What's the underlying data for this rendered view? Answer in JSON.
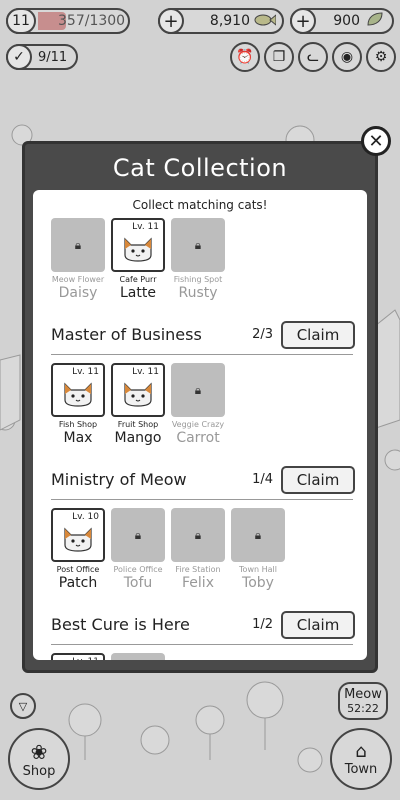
{
  "hud": {
    "level": "11",
    "xp": "357/1300",
    "fish": "8,910",
    "leaves": "900",
    "tasks": "9/11"
  },
  "modal": {
    "title": "Cat Collection",
    "subtitle": "Collect matching cats!",
    "close": "✕",
    "groups": [
      {
        "title": "",
        "count": "",
        "cats": [
          {
            "shop": "Meow Flower",
            "name": "Daisy",
            "unlocked": false
          },
          {
            "shop": "Cafe Purr",
            "name": "Latte",
            "unlocked": true,
            "level": "Lv. 11"
          },
          {
            "shop": "Fishing Spot",
            "name": "Rusty",
            "unlocked": false
          }
        ]
      },
      {
        "title": "Master of Business",
        "count": "2/3",
        "claim": "Claim",
        "cats": [
          {
            "shop": "Fish Shop",
            "name": "Max",
            "unlocked": true,
            "level": "Lv. 11"
          },
          {
            "shop": "Fruit Shop",
            "name": "Mango",
            "unlocked": true,
            "level": "Lv. 11"
          },
          {
            "shop": "Veggie Crazy",
            "name": "Carrot",
            "unlocked": false
          }
        ]
      },
      {
        "title": "Ministry of Meow",
        "count": "1/4",
        "claim": "Claim",
        "cats": [
          {
            "shop": "Post Office",
            "name": "Patch",
            "unlocked": true,
            "level": "Lv. 10"
          },
          {
            "shop": "Police Office",
            "name": "Tofu",
            "unlocked": false
          },
          {
            "shop": "Fire Station",
            "name": "Felix",
            "unlocked": false
          },
          {
            "shop": "Town Hall",
            "name": "Toby",
            "unlocked": false
          }
        ]
      },
      {
        "title": "Best Cure is Here",
        "count": "1/2",
        "claim": "Claim",
        "cats": [
          {
            "shop": "",
            "name": "",
            "unlocked": true,
            "level": "Lv. 11"
          },
          {
            "shop": "",
            "name": "",
            "unlocked": false
          }
        ]
      }
    ]
  },
  "bottom": {
    "shop": "Shop",
    "town": "Town",
    "meow": "Meow",
    "timer": "52:22"
  },
  "icons": [
    "plus-icon",
    "fish-icon",
    "leaf-icon",
    "check-icon",
    "alarm-icon",
    "cards-icon",
    "cat-face-icon",
    "camera-icon",
    "gear-icon",
    "close-icon",
    "lock-icon",
    "paw-icon",
    "town-cat-icon",
    "chevron-down-icon"
  ]
}
